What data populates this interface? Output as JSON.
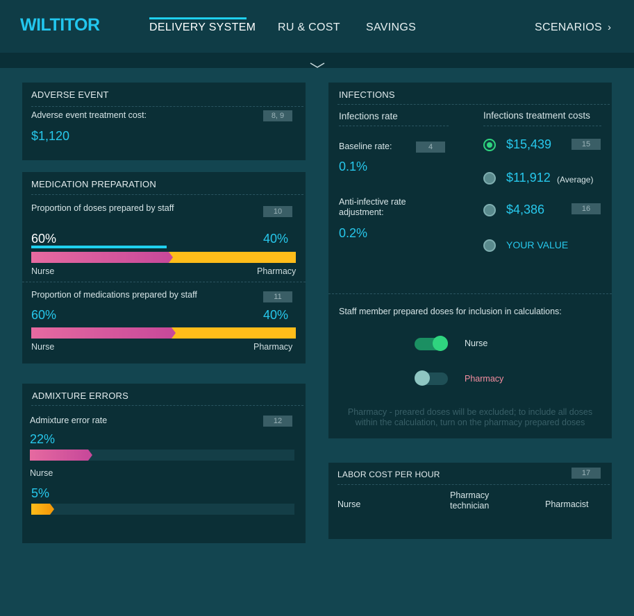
{
  "brand": "WILTITOR",
  "nav": {
    "items": [
      "DELIVERY SYSTEM",
      "RU & COST",
      "SAVINGS"
    ],
    "scenarios": "SCENARIOS"
  },
  "adverse": {
    "title": "ADVERSE EVENT",
    "label": "Adverse event treatment cost:",
    "badge": "8, 9",
    "value": "$1,120"
  },
  "medprep": {
    "title": "MEDICATION PREPARATION",
    "doses": {
      "label": "Proportion of doses prepared by staff",
      "badge": "10",
      "nurse_pct": "60%",
      "pharmacy_pct": "40%",
      "nurse_fraction": 0.52,
      "left_label": "Nurse",
      "right_label": "Pharmacy"
    },
    "meds": {
      "label": "Proportion of medications  prepared by staff",
      "badge": "11",
      "nurse_pct": "60%",
      "pharmacy_pct": "40%",
      "nurse_fraction": 0.53,
      "left_label": "Nurse",
      "right_label": "Pharmacy"
    }
  },
  "admixture": {
    "title": "ADMIXTURE ERRORS",
    "label": "Admixture error rate",
    "badge": "12",
    "nurse_value": "22%",
    "nurse_fraction": 0.22,
    "nurse_label": "Nurse",
    "pharmacy_value": "5%",
    "pharmacy_fraction": 0.07
  },
  "infections": {
    "title": "INFECTIONS",
    "rate_heading": "Infections rate",
    "costs_heading": "Infections treatment costs",
    "baseline": {
      "label": "Baseline rate:",
      "badge": "4",
      "value": "0.1%"
    },
    "anti": {
      "label_line1": "Anti-infective rate",
      "label_line2": "adjustment:",
      "value": "0.2%"
    },
    "options": [
      {
        "value": "$15,439",
        "badge": "15",
        "selected": true
      },
      {
        "value": "$11,912",
        "suffix": "(Average)",
        "selected": false
      },
      {
        "value": "$4,386",
        "badge": "16",
        "selected": false
      },
      {
        "value": "YOUR VALUE",
        "selected": false
      }
    ],
    "staff_heading": "Staff member prepared doses for inclusion in calculations:",
    "toggles": [
      {
        "label": "Nurse",
        "on": true
      },
      {
        "label": "Pharmacy",
        "on": false
      }
    ],
    "note_line1": "Pharmacy - preared doses will be excluded; to include all doses",
    "note_line2": "within the calculation, turn on the pharmacy prepared doses"
  },
  "labor": {
    "title": "LABOR COST PER HOUR",
    "badge": "17",
    "columns": [
      "Nurse",
      "Pharmacy technician",
      "Pharmacist"
    ],
    "tech_line1": "Pharmacy",
    "tech_line2": "technician"
  },
  "colors": {
    "accent": "#27c8ec",
    "nurse_bar": "#e66aa0",
    "pharmacy_bar": "#ffbd1a",
    "toggle_on": "#2fd47f",
    "pharmacy_off_label": "#f58ea0"
  }
}
